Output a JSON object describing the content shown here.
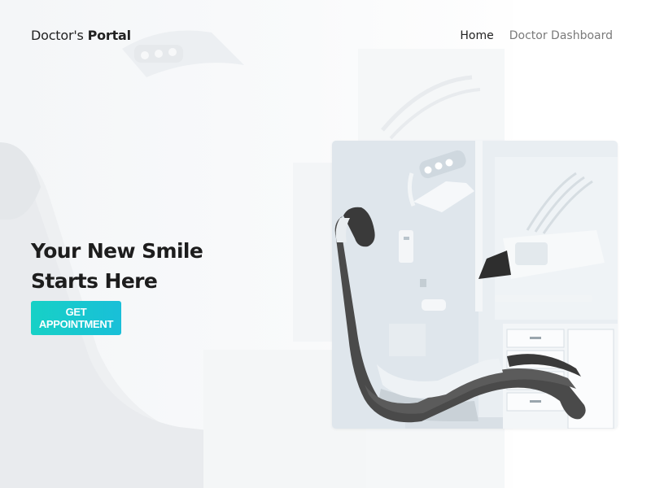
{
  "header": {
    "brand": {
      "prefix": "Doctor's",
      "strong": "Portal"
    },
    "nav": [
      {
        "label": "Home",
        "active": true
      },
      {
        "label": "Doctor Dashboard",
        "active": false
      }
    ]
  },
  "hero": {
    "title_line1": "Your New Smile",
    "title_line2": "Starts Here",
    "cta_label": "GET APPOINTMENT"
  },
  "colors": {
    "accent_start": "#17d1c6",
    "accent_end": "#19bfd8"
  },
  "icons": {
    "hero_image": "dental-chair-photo",
    "background": "faded-dental-clinic-photo"
  }
}
